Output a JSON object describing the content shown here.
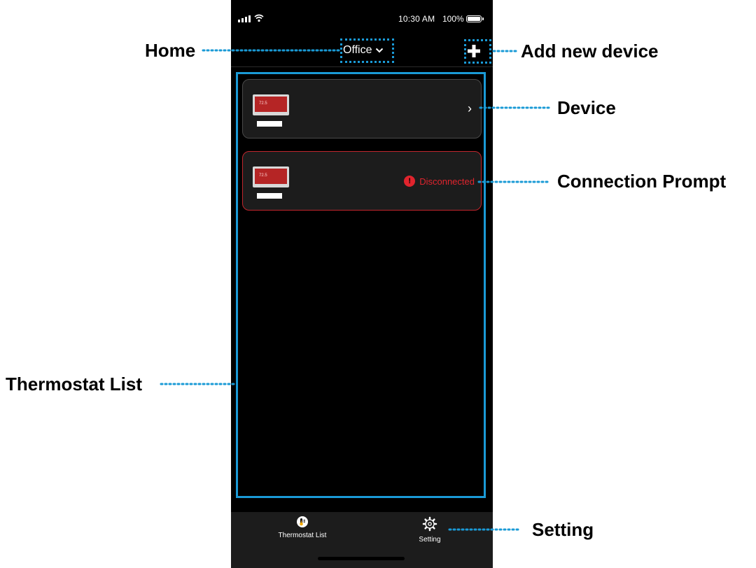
{
  "status_bar": {
    "time": "10:30 AM",
    "battery_percent": "100%"
  },
  "header": {
    "home_name": "Office"
  },
  "devices": [
    {
      "status": "connected",
      "thumb_text": "72.5"
    },
    {
      "status": "disconnected",
      "status_label": "Disconnected",
      "thumb_text": "72.5"
    }
  ],
  "tabs": [
    {
      "label": "Thermostat List",
      "icon": "thermometer-icon"
    },
    {
      "label": "Setting",
      "icon": "gear-icon"
    }
  ],
  "annotations": {
    "home": "Home",
    "add_new_device": "Add new device",
    "device": "Device",
    "connection_prompt": "Connection Prompt",
    "thermostat_list": "Thermostat List",
    "setting": "Setting"
  },
  "colors": {
    "accent": "#1a9ad6",
    "error": "#e0242d",
    "background": "#000000",
    "card": "#1c1c1c"
  }
}
